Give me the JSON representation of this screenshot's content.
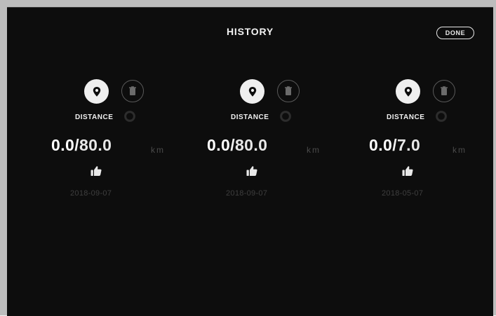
{
  "header": {
    "title": "HISTORY",
    "done_label": "DONE"
  },
  "history": [
    {
      "metric_label": "DISTANCE",
      "current": "0.0",
      "separator": "/",
      "target": "80.0",
      "unit": "km",
      "date": "2018-09-07"
    },
    {
      "metric_label": "DISTANCE",
      "current": "0.0",
      "separator": "/",
      "target": "80.0",
      "unit": "km",
      "date": "2018-09-07"
    },
    {
      "metric_label": "DISTANCE",
      "current": "0.0",
      "separator": "/",
      "target": "7.0",
      "unit": "km",
      "date": "2018-05-07"
    }
  ],
  "icons": {
    "pin": "location-pin-icon",
    "trash": "trash-icon",
    "status": "status-icon",
    "thumb": "thumbs-up-icon"
  },
  "colors": {
    "background": "#0d0d0d",
    "primary_text": "#f2f2f2",
    "muted_text": "#4b4b4b",
    "pin_circle": "#efefef"
  }
}
